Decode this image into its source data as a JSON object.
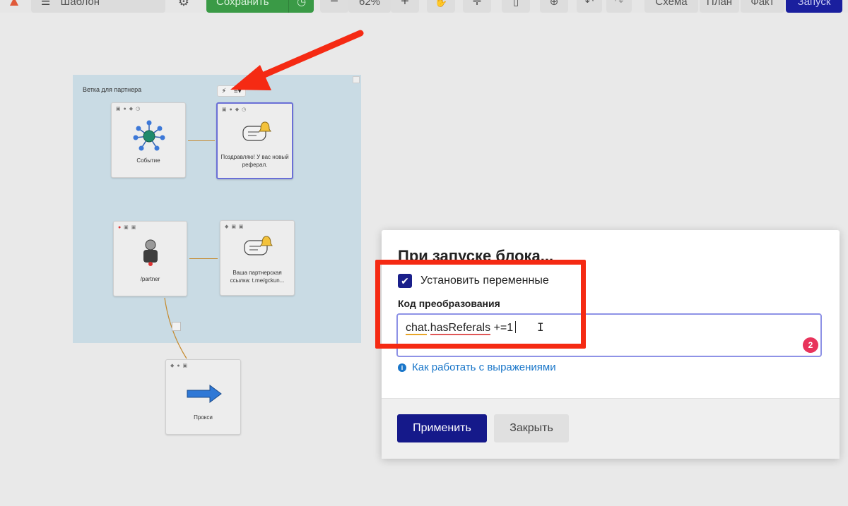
{
  "toolbar": {
    "template_label": "Шаблон",
    "save_label": "Сохранить",
    "zoom_value": "62%",
    "minus_label": "−",
    "plus_label": "+",
    "tabs": {
      "scheme": "Схема",
      "plan": "План",
      "fact": "Факт",
      "run": "Запуск"
    }
  },
  "canvas": {
    "branch_title": "Ветка для партнера",
    "nodes": {
      "event": "Событие",
      "congrats": "Поздравляю! У вас новый реферал.",
      "partner": "/partner",
      "link": "Ваша партнерская ссылка: t.me/gckun...",
      "proxy": "Прокси"
    }
  },
  "dialog": {
    "title": "При запуске блока...",
    "checkbox_label": "Установить переменные",
    "checkbox_checked": true,
    "code_label": "Код преобразования",
    "code_parts": {
      "word1": "chat",
      "dot": ".",
      "word2": "hasReferals",
      "rest": " +=1"
    },
    "badge_count": "2",
    "help_link": "Как работать с выражениями",
    "apply_label": "Применить",
    "close_label": "Закрыть"
  },
  "colors": {
    "save_green": "#3a9a46",
    "run_blue": "#1a1f9e",
    "apply_blue": "#15198a",
    "highlight_red": "#f52a13",
    "badge_pink": "#e8335b",
    "link_blue": "#1976c9"
  }
}
